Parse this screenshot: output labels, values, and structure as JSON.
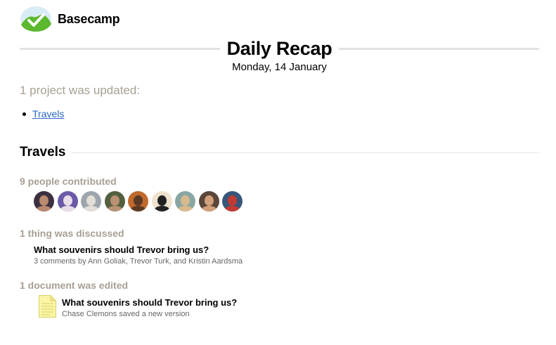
{
  "header": {
    "brand_name": "Basecamp",
    "logo_icon": "basecamp-mountain-logo",
    "brand_color": "#5cb82e"
  },
  "recap": {
    "title": "Daily Recap",
    "date": "Monday, 14 January",
    "projects_updated": "1 project was updated:",
    "projects": [
      {
        "name": "Travels"
      }
    ]
  },
  "project": {
    "name": "Travels",
    "contributors_heading": "9 people contributed",
    "contributors": [
      {
        "avatar": "avatar-1",
        "bg": "#3b3040",
        "skin": "#b98a6e"
      },
      {
        "avatar": "avatar-2",
        "bg": "#6b5aa8",
        "skin": "#e9dde8"
      },
      {
        "avatar": "avatar-3",
        "bg": "#9ea5ad",
        "skin": "#e3ded6"
      },
      {
        "avatar": "avatar-4",
        "bg": "#53603f",
        "skin": "#b99274"
      },
      {
        "avatar": "avatar-5",
        "bg": "#c06a2c",
        "skin": "#5a3a24"
      },
      {
        "avatar": "avatar-6",
        "bg": "#efe3cf",
        "skin": "#222222"
      },
      {
        "avatar": "avatar-7",
        "bg": "#8aa6a3",
        "skin": "#d9b98e"
      },
      {
        "avatar": "avatar-8",
        "bg": "#5a463a",
        "skin": "#d2a07c"
      },
      {
        "avatar": "avatar-9",
        "bg": "#37567a",
        "skin": "#c23a33"
      }
    ],
    "discussed_heading": "1 thing was discussed",
    "discussion": {
      "title": "What souvenirs should Trevor bring us?",
      "meta": "3 comments by Ann Goliak, Trevor Turk, and Kristin Aardsma"
    },
    "edited_heading": "1 document was edited",
    "document": {
      "icon": "document-icon",
      "title": "What souvenirs should Trevor bring us?",
      "meta": "Chase Clemons saved a new version"
    }
  },
  "colors": {
    "muted_heading": "#a89f92",
    "link": "#2a67c4",
    "rule": "#e2e2e2",
    "doc_yellow": "#fbf6a6"
  }
}
